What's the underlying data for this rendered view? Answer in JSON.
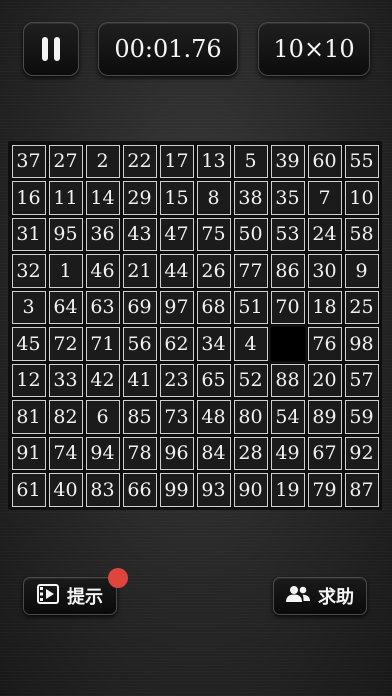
{
  "header": {
    "pause_icon": "pause-icon",
    "timer": "00:01.76",
    "grid_size": "10×10"
  },
  "board": {
    "rows": 10,
    "cols": 10,
    "empty_value": 0,
    "tiles": [
      [
        37,
        27,
        2,
        22,
        17,
        13,
        5,
        39,
        60,
        55
      ],
      [
        16,
        11,
        14,
        29,
        15,
        8,
        38,
        35,
        7,
        10
      ],
      [
        31,
        95,
        36,
        43,
        47,
        75,
        50,
        53,
        24,
        58
      ],
      [
        32,
        1,
        46,
        21,
        44,
        26,
        77,
        86,
        30,
        9
      ],
      [
        3,
        64,
        63,
        69,
        97,
        68,
        51,
        70,
        18,
        25
      ],
      [
        45,
        72,
        71,
        56,
        62,
        34,
        4,
        0,
        76,
        98
      ],
      [
        12,
        33,
        42,
        41,
        23,
        65,
        52,
        88,
        20,
        57
      ],
      [
        81,
        82,
        6,
        85,
        73,
        48,
        80,
        54,
        89,
        59
      ],
      [
        91,
        74,
        94,
        78,
        96,
        84,
        28,
        49,
        67,
        92
      ],
      [
        61,
        40,
        83,
        66,
        99,
        93,
        90,
        19,
        79,
        87
      ]
    ]
  },
  "footer": {
    "hint_label": "提示",
    "hint_icon": "film-icon",
    "hint_badge_color": "#e0453d",
    "help_label": "求助",
    "help_icon": "people-icon"
  }
}
